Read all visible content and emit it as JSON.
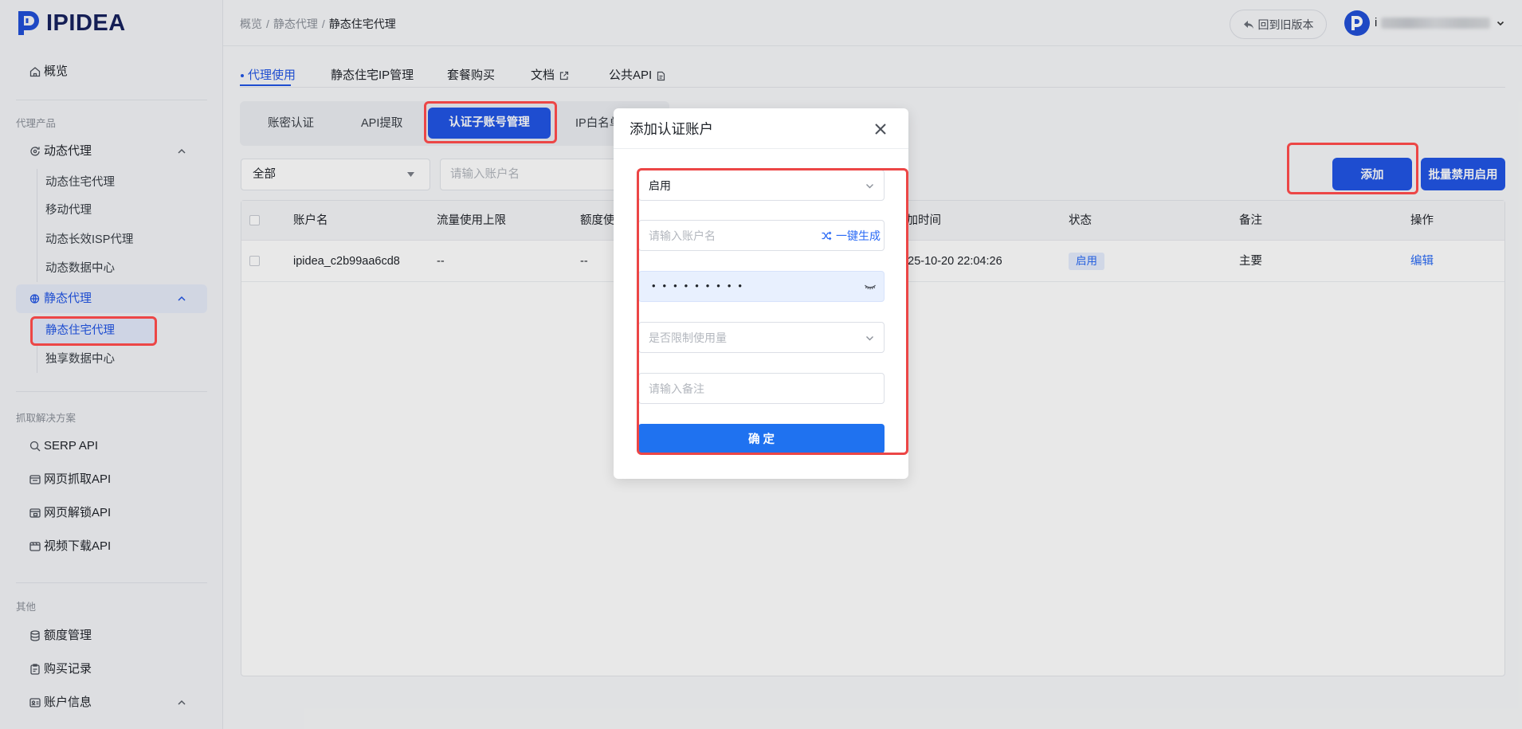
{
  "app": {
    "logo_text": "IPIDEA",
    "colors": {
      "primary": "#2155e5",
      "link": "#2a6af5",
      "confirm": "#1f72f0",
      "annotation": "#ec4646"
    }
  },
  "sidebar": {
    "overview": "概览",
    "group_products": "代理产品",
    "dynamic_proxy": "动态代理",
    "dynamic_items": [
      "动态住宅代理",
      "移动代理",
      "动态长效ISP代理",
      "动态数据中心"
    ],
    "static_proxy": "静态代理",
    "static_items": [
      "静态住宅代理",
      "独享数据中心"
    ],
    "group_scraping": "抓取解决方案",
    "scraping_items": [
      "SERP API",
      "网页抓取API",
      "网页解锁API",
      "视频下载API"
    ],
    "group_other": "其他",
    "other_items": [
      "额度管理",
      "购买记录",
      "账户信息"
    ],
    "active_static_index": 0,
    "icons": [
      "home-icon",
      "dynamic-proxy-icon",
      "static-proxy-icon",
      "search-icon",
      "browser-icon",
      "unlock-browser-icon",
      "video-icon",
      "database-icon",
      "clipboard-icon",
      "id-card-icon"
    ]
  },
  "header": {
    "breadcrumb": [
      "概览",
      "静态代理",
      "静态住宅代理"
    ],
    "breadcrumb_separator": "/",
    "old_version_button": "回到旧版本",
    "user_name": "i"
  },
  "tabs": {
    "items": [
      "代理使用",
      "静态住宅IP管理",
      "套餐购买",
      "文档",
      "公共API"
    ],
    "active_index": 0
  },
  "subtabs": {
    "items": [
      "账密认证",
      "API提取",
      "认证子账号管理",
      "IP白名单"
    ],
    "active_index": 2
  },
  "filters": {
    "status_value": "全部",
    "account_placeholder": "请输入账户名",
    "add_button": "添加",
    "batch_button": "批量禁用启用"
  },
  "table": {
    "columns": [
      "账户名",
      "流量使用上限",
      "额度使用",
      "添加时间",
      "状态",
      "备注",
      "操作"
    ],
    "rows": [
      {
        "account": "ipidea_c2b99aa6cd8",
        "traffic_limit": "--",
        "quota_used": "--",
        "created_at": "2025-10-20 22:04:26",
        "status": "启用",
        "remark": "主要",
        "action": "编辑"
      }
    ]
  },
  "modal": {
    "title": "添加认证账户",
    "status_value": "启用",
    "username_placeholder": "请输入账户名",
    "generate_label": "一键生成",
    "password_mask": "•••••••••",
    "usage_limit_placeholder": "是否限制使用量",
    "remark_placeholder": "请输入备注",
    "confirm_button": "确 定"
  }
}
